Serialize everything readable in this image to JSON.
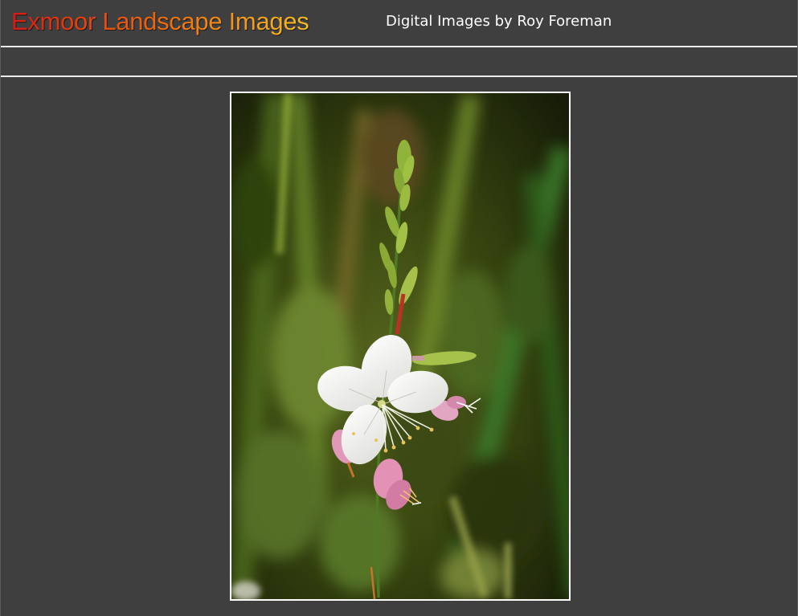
{
  "header": {
    "site_title": "Exmoor Landscape Images",
    "subtitle": "Digital Images by Roy Foreman"
  },
  "navbar": {},
  "photo": {
    "subject": "gaura-flower"
  },
  "colors": {
    "page_background": "#3f3f3f",
    "divider": "#ececec",
    "title_gradient_start": "#d61a14",
    "title_gradient_end": "#f5bb26",
    "subtitle_text": "#ffffff",
    "photo_border": "#ffffff"
  }
}
